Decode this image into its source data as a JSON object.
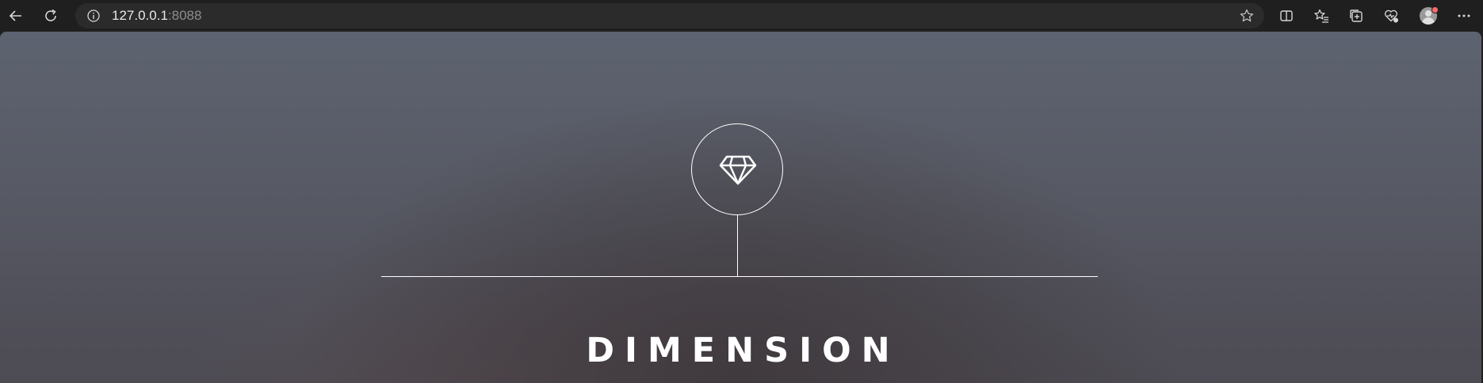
{
  "browser": {
    "address": {
      "host": "127.0.0.1",
      "port": ":8088"
    },
    "icons": {
      "back": "back-arrow-icon",
      "refresh": "refresh-icon",
      "info": "info-icon",
      "favorite": "star-icon",
      "split_screen": "split-screen-icon",
      "favorites": "favorites-list-icon",
      "collections": "collections-icon",
      "health": "browser-essentials-icon",
      "profile": "profile-avatar",
      "more": "more-options-icon"
    }
  },
  "page": {
    "logo_icon": "diamond-icon",
    "title": "DIMENSION"
  },
  "colors": {
    "browser_bg": "#1f1f1f",
    "address_bg": "#2b2b2b",
    "text_white": "#ffffff",
    "port_gray": "#8d8d8d",
    "notification": "#ff6b6b"
  }
}
